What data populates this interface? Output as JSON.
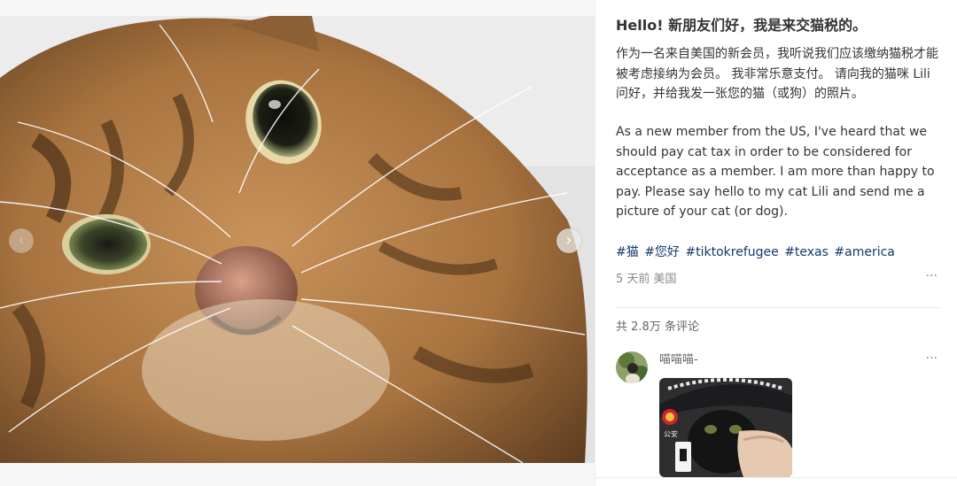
{
  "post": {
    "title": "Hello! 新朋友们好，我是来交猫税的。",
    "body_cn": "作为一名来自美国的新会员，我听说我们应该缴纳猫税才能被考虑接纳为会员。 我非常乐意支付。 请向我的猫咪 Lili 问好，并给我发一张您的猫（或狗）的照片。",
    "body_en": "As a new member from the US, I've heard that we should pay cat tax in order to be considered for acceptance as a member. I am more than happy to pay. Please say hello to my cat Lili and send me a picture of your cat (or dog).",
    "tags": [
      "#猫",
      "#您好",
      "#tiktokrefugee",
      "#texas",
      "#america"
    ],
    "meta": "5 天前 美国",
    "more": "···"
  },
  "gallery": {
    "prev_icon": "‹",
    "next_icon": "›"
  },
  "comments": {
    "count_label": "共 2.8万 条评论",
    "items": [
      {
        "author": "喵喵喵-",
        "more": "···",
        "image_badge_text": "公安"
      }
    ]
  },
  "colors": {
    "tag": "#13386c",
    "text": "#333333",
    "muted": "#8a8a8a"
  }
}
